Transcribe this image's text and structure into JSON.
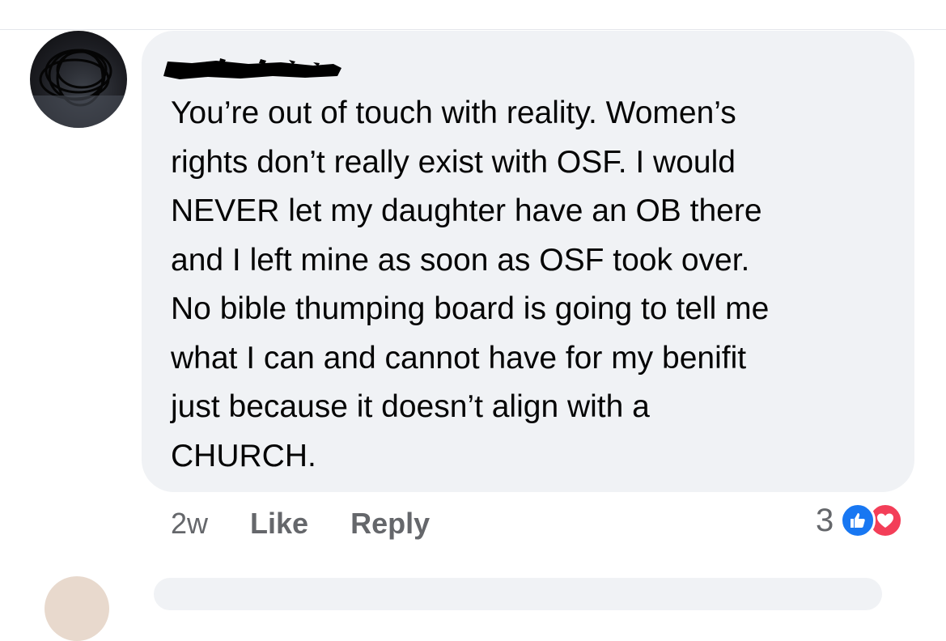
{
  "comment": {
    "author_name": "",
    "text": "You’re out of touch with reality. Women’s\nrights don’t really exist with OSF. I would\nNEVER let my daughter have an OB there\nand I left mine as soon as OSF took over.\nNo bible thumping board is going to tell me\nwhat I can and cannot have for my benifit\njust because it doesn’t align with a\nCHURCH.",
    "timestamp": "2w",
    "like_label": "Like",
    "reply_label": "Reply",
    "reaction_count": "3",
    "reactions": [
      "like-icon",
      "love-icon"
    ]
  },
  "colors": {
    "bubble_bg": "#f0f2f5",
    "text": "#050505",
    "meta": "#65676b",
    "like_blue": "#1877f2",
    "love_red": "#f33e58"
  }
}
